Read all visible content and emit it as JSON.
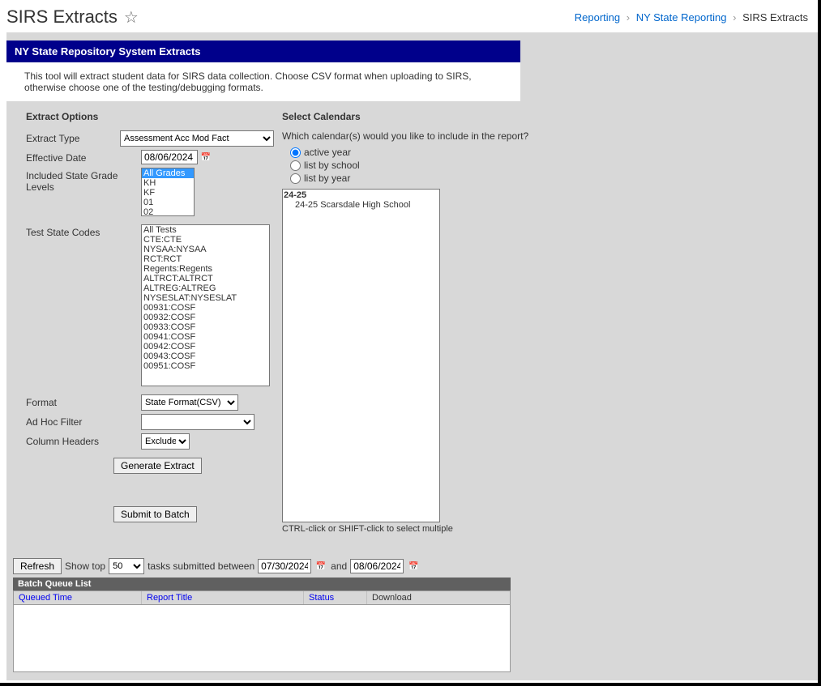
{
  "header": {
    "title": "SIRS Extracts",
    "breadcrumb": {
      "a": "Reporting",
      "b": "NY State Reporting",
      "c": "SIRS Extracts"
    }
  },
  "panel": {
    "title": "NY State Repository System Extracts",
    "description": "This tool will extract student data for SIRS data collection. Choose CSV format when uploading to SIRS, otherwise choose one of the testing/debugging formats."
  },
  "options": {
    "section_title": "Extract Options",
    "labels": {
      "extract_type": "Extract Type",
      "effective_date": "Effective Date",
      "grade_levels": "Included State Grade Levels",
      "test_codes": "Test State Codes",
      "format": "Format",
      "adhoc": "Ad Hoc Filter",
      "headers": "Column Headers"
    },
    "extract_type_value": "Assessment Acc Mod Fact",
    "effective_date": "08/06/2024",
    "grades": [
      "All Grades",
      "KH",
      "KF",
      "01",
      "02"
    ],
    "grade_selected": "All Grades",
    "tests": [
      "All Tests",
      "CTE:CTE",
      "NYSAA:NYSAA",
      "RCT:RCT",
      "Regents:Regents",
      "ALTRCT:ALTRCT",
      "ALTREG:ALTREG",
      "NYSESLAT:NYSESLAT",
      "00931:COSF",
      "00932:COSF",
      "00933:COSF",
      "00941:COSF",
      "00942:COSF",
      "00943:COSF",
      "00951:COSF"
    ],
    "format_value": "State Format(CSV)",
    "adhoc_value": "",
    "headers_value": "Exclude",
    "buttons": {
      "generate": "Generate Extract",
      "submit": "Submit to Batch"
    }
  },
  "calendars": {
    "section_title": "Select Calendars",
    "prompt": "Which calendar(s) would you like to include in the report?",
    "radios": {
      "active": "active year",
      "school": "list by school",
      "year": "list by year"
    },
    "tree": {
      "year": "24-25",
      "child": "24-25 Scarsdale High School"
    },
    "hint": "CTRL-click or SHIFT-click to select multiple"
  },
  "batch": {
    "refresh": "Refresh",
    "show_top": "Show top",
    "show_top_value": "50",
    "tasks_between": "tasks submitted between",
    "date_from": "07/30/2024",
    "and": "and",
    "date_to": "08/06/2024",
    "list_title": "Batch Queue List",
    "cols": {
      "queued": "Queued Time",
      "report": "Report Title",
      "status": "Status",
      "download": "Download"
    }
  }
}
